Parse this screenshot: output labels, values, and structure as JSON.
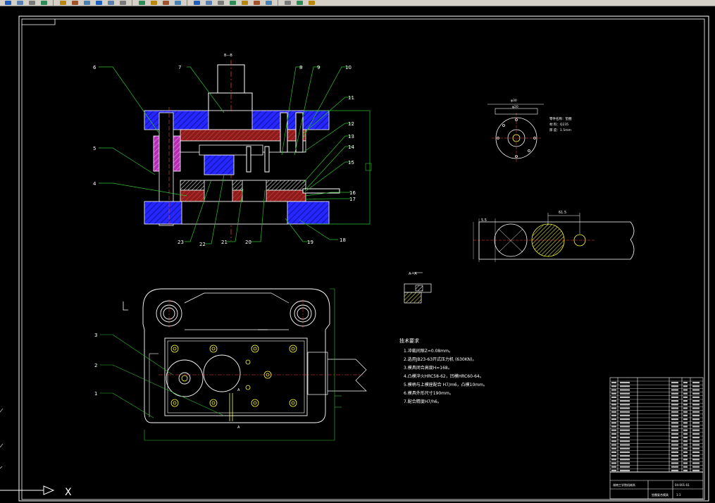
{
  "toolbar": {
    "icons": [
      "save-icon",
      "print-icon",
      "preview-icon",
      "publish-icon",
      "cut-icon",
      "copy-icon",
      "paste-icon",
      "match-properties-icon",
      "undo-icon",
      "redo-icon",
      "pan-icon",
      "zoom-realtime-icon",
      "zoom-window-icon",
      "zoom-previous-icon",
      "properties-icon",
      "design-center-icon",
      "tool-palettes-icon",
      "sheet-set-icon",
      "markup-icon",
      "calculator-icon",
      "help-icon"
    ],
    "layer_icons": [
      "layer-manager-icon",
      "layer-state-icon",
      "layer-previous-icon"
    ],
    "colors": {
      "background": "#d4d0c8",
      "accent": "#1f5fbf"
    }
  },
  "drawing": {
    "section_label": "A—A",
    "view_label_top": "B—B",
    "part_numbers_left": [
      "6",
      "5",
      "4",
      "23",
      "22",
      "21",
      "20"
    ],
    "part_numbers_top": [
      "7",
      "8",
      "9",
      "10"
    ],
    "part_numbers_right": [
      "11",
      "12",
      "13",
      "14",
      "15",
      "16",
      "17",
      "18",
      "19"
    ],
    "part_numbers_plan": [
      "3",
      "2",
      "1"
    ],
    "plan_markers": [
      "A",
      "A"
    ],
    "blank_dims": [
      "φ30",
      "φ20"
    ],
    "part_info": [
      "零件名称：垫圈",
      "材 料：Q235",
      "厚 度：1.5mm"
    ],
    "strip_dims": [
      "61.5",
      "5.5"
    ],
    "tech_req_title": "技术要求",
    "tech_req": [
      "1.冲裁间隙Z=0.08mm。",
      "2.选用JB23-63开式压力机 (630KN)。",
      "3.模具闭合高度H=168。",
      "4.凸模淬火HRC58-62，凹模HRC60-64。",
      "5.模柄与上模座配合 H7/m6，凸模10mm。",
      "6.模具外形尺寸190mm。",
      "7.配合精度H7/h6。"
    ],
    "title_block": {
      "school": "湖南工学院机械系",
      "drawing_name": "垫圈复合模具",
      "drawing_no": "04-001-01",
      "scale": "1:1"
    },
    "ucs_x": "X",
    "colors": {
      "background": "#000000",
      "line": "#ffffff",
      "blue": "#2626ff",
      "magenta": "#cc44cc",
      "red": "#a02020",
      "green": "#30c030",
      "yellow": "#ffff40",
      "cyan": "#40c0c0"
    }
  }
}
